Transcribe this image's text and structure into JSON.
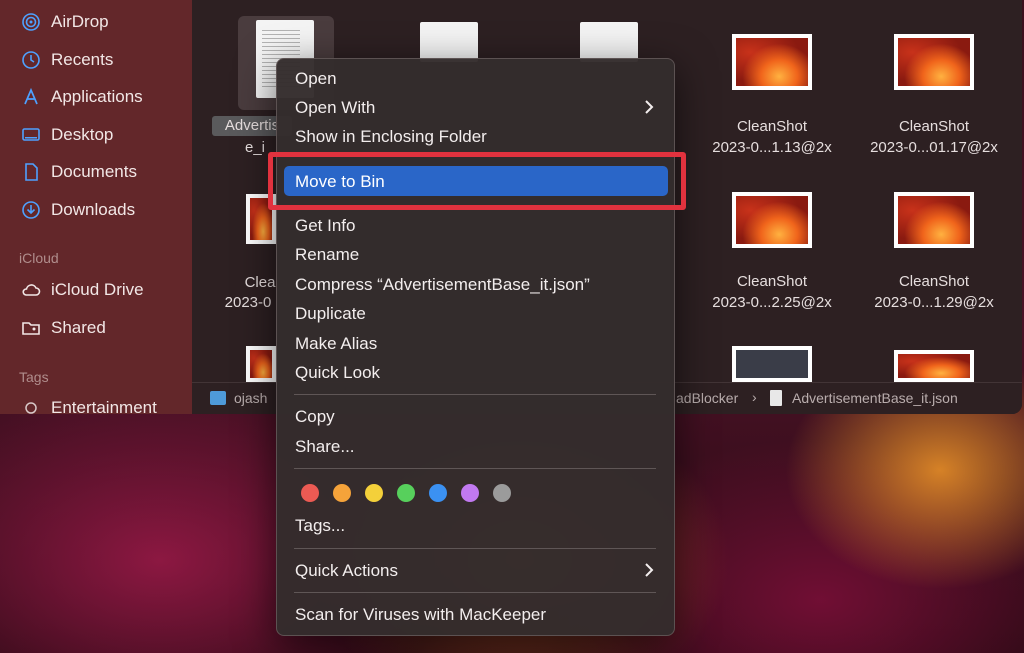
{
  "sidebar": {
    "items": [
      {
        "label": "AirDrop",
        "icon": "airdrop-icon"
      },
      {
        "label": "Recents",
        "icon": "clock-icon"
      },
      {
        "label": "Applications",
        "icon": "applications-icon"
      },
      {
        "label": "Desktop",
        "icon": "desktop-icon"
      },
      {
        "label": "Documents",
        "icon": "document-icon"
      },
      {
        "label": "Downloads",
        "icon": "download-icon"
      }
    ],
    "icloud_heading": "iCloud",
    "icloud_items": [
      {
        "label": "iCloud Drive",
        "icon": "cloud-icon"
      },
      {
        "label": "Shared",
        "icon": "shared-folder-icon"
      }
    ],
    "tags_heading": "Tags",
    "tag_items": [
      {
        "label": "Entertainment",
        "icon": "tag-circle-icon"
      }
    ]
  },
  "files": [
    {
      "name_line1": "Advertis",
      "name_line2": "e_i"
    },
    {
      "name_line1": "Clea",
      "name_line2": "2023-0"
    },
    {
      "name_line1": "CleanShot",
      "name_line2": "2023-0...1.13@2x"
    },
    {
      "name_line1": "CleanShot",
      "name_line2": "2023-0...01.17@2x"
    },
    {
      "name_line1": "CleanShot",
      "name_line2": "2023-0...2.25@2x"
    },
    {
      "name_line1": "CleanShot",
      "name_line2": "2023-0...1.29@2x"
    }
  ],
  "pathbar": {
    "left": "ojash",
    "middle": "adBlocker",
    "separator": "›",
    "file": "AdvertisementBase_it.json"
  },
  "context_menu": {
    "open": "Open",
    "open_with": "Open With",
    "show_enclosing": "Show in Enclosing Folder",
    "move_to_bin": "Move to Bin",
    "get_info": "Get Info",
    "rename": "Rename",
    "compress": "Compress “AdvertisementBase_it.json”",
    "duplicate": "Duplicate",
    "make_alias": "Make Alias",
    "quick_look": "Quick Look",
    "copy": "Copy",
    "share": "Share...",
    "tags": "Tags...",
    "quick_actions": "Quick Actions",
    "scan": "Scan for Viruses with MacKeeper",
    "tag_colors": [
      "#ec5a53",
      "#f5a33a",
      "#f4d03a",
      "#57d05c",
      "#3b91f2",
      "#c179f0",
      "#9b9b9b"
    ]
  },
  "colors": {
    "highlight": "#2a66c8",
    "annotation_box": "#e1323e"
  }
}
